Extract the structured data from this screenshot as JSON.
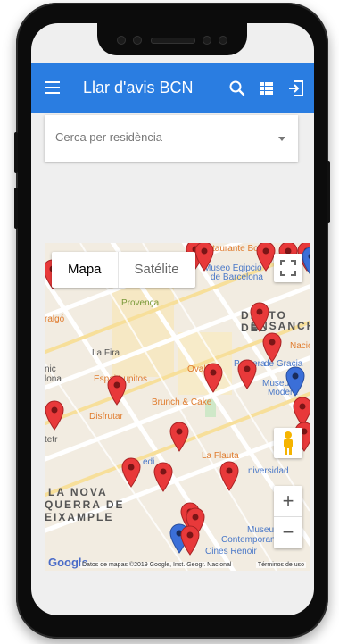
{
  "appbar": {
    "title": "Llar d'avis BCN",
    "menu_icon": "hamburger-icon",
    "search_icon": "search-icon",
    "grid_icon": "grid-icon",
    "exit_icon": "exit-icon",
    "color": "#2a7de1"
  },
  "search": {
    "placeholder": "Cerca per residència"
  },
  "map": {
    "type_map": "Mapa",
    "type_satellite": "Satélite",
    "labels": {
      "restaurant": "staurante Bo",
      "museum_egypt_1": "Museo Egipcio",
      "museum_egypt_2": "de Barcelona",
      "provenca": "Provença",
      "aragon": "ralgó",
      "lafira": "La Fira",
      "espai": "Espai Lupitos",
      "oval": "Oval",
      "pedrera": "Pedrera",
      "gracia": "de Gracia",
      "museu_mod_1": "Museu",
      "museu_mod_2": "Modern",
      "brunch": "Brunch & Cake",
      "disfrutar": "Disfrutar",
      "flauta": "La Flauta",
      "universidad": "niversidad",
      "nacio": "Nacio",
      "tetr": "tetr",
      "museu_contemp_1": "Museu",
      "museu_contemp_2": "Contemporan",
      "cines": "Cines Renoir",
      "edi": "edi",
      "inic": "nic",
      "lona": "lona"
    },
    "districts": {
      "dreta_1": "DIS TO DEL",
      "dreta_2": "ENSANCHE",
      "nova_1": "LA NOVA",
      "nova_2": "QUERRA DE",
      "nova_3": "EIXAMPLE"
    },
    "google": "Google",
    "attribution": "Datos de mapas ©2019 Google, Inst. Geogr. Nacional",
    "terms": "Términos de uso",
    "zoom_in": "+",
    "zoom_out": "−"
  },
  "colors": {
    "pin_red": "#e8393a",
    "pin_blue": "#3b6fd8"
  }
}
